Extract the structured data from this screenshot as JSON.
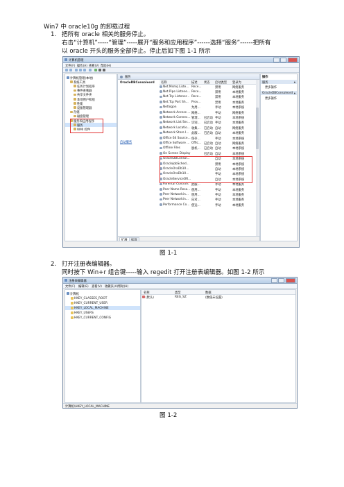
{
  "doc": {
    "title": "Win7 中 oracle10g  的卸载过程",
    "step1": {
      "number": "1.",
      "text": "把所有 oracle 相关的服务停止。"
    },
    "step1_desc_line1": "右击“计算机”-----“管理”-----展开“服务和应用程序”------选择“服务”------把所有",
    "step1_desc_line2": "以 oracle 开头的服务全部停止。停止后如下图 1-1 所示",
    "fig1_caption": "图 1-1",
    "step2": {
      "number": "2.",
      "text": "打开注册表编辑器。"
    },
    "step2_desc": "同时按下 Win+r 组合键-----输入 regedit 打开注册表编辑器。如图 1-2 所示",
    "fig2_caption": "图 1-2"
  },
  "screenshot1": {
    "title": "计算机管理",
    "menu": [
      "文件(F)",
      "操作(A)",
      "查看(V)",
      "帮助(H)"
    ],
    "tree": [
      {
        "label": "计算机管理(本地)",
        "indent": 0
      },
      {
        "label": "系统工具",
        "indent": 1
      },
      {
        "label": "任务计划程序",
        "indent": 2
      },
      {
        "label": "事件查看器",
        "indent": 2
      },
      {
        "label": "共享文件夹",
        "indent": 2
      },
      {
        "label": "本地用户和组",
        "indent": 2
      },
      {
        "label": "性能",
        "indent": 2
      },
      {
        "label": "设备管理器",
        "indent": 2
      },
      {
        "label": "存储",
        "indent": 1
      },
      {
        "label": "磁盘管理",
        "indent": 2
      },
      {
        "label": "服务和应用程序",
        "indent": 1
      },
      {
        "label": "服务",
        "indent": 2
      },
      {
        "label": "WMI 控件",
        "indent": 2
      }
    ],
    "header_label": "服务",
    "selected_service": "OracleDBConsoleord",
    "link_stop": "启动服务",
    "columns": [
      "名称",
      "描述",
      "状态",
      "启动类型",
      "登录为"
    ],
    "services": [
      [
        "Net.Msmq Liste...",
        "Rece...",
        "",
        "禁用",
        "网络服务"
      ],
      [
        "Net.Pipe Listene...",
        "Rece...",
        "",
        "禁用",
        "本地服务"
      ],
      [
        "Net.Tcp Listener...",
        "Rece...",
        "",
        "禁用",
        "本地服务"
      ],
      [
        "Net.Tcp Port Sh...",
        "Prov...",
        "",
        "禁用",
        "本地服务"
      ],
      [
        "Netlogon",
        "为用...",
        "",
        "手动",
        "本地系统"
      ],
      [
        "Network Access ...",
        "网络...",
        "",
        "手动",
        "网络服务"
      ],
      [
        "Network Connec...",
        "管理...",
        "已启动",
        "手动",
        "本地系统"
      ],
      [
        "Network List Ser...",
        "识别...",
        "已启动",
        "手动",
        "本地服务"
      ],
      [
        "Network Locatio...",
        "收集...",
        "已启动",
        "自动",
        "网络服务"
      ],
      [
        "Network Store I...",
        "此服...",
        "已启动",
        "自动",
        "本地服务"
      ],
      [
        "Office 64 Source...",
        "保存...",
        "",
        "手动",
        "本地系统"
      ],
      [
        "Office Software ...",
        "Offic...",
        "已启动",
        "自动",
        "网络服务"
      ],
      [
        "Offline Files",
        "脱机...",
        "已启动",
        "自动",
        "本地系统"
      ],
      [
        "On Screen Display",
        "",
        "已启动",
        "自动",
        "本地系统"
      ],
      [
        "OracleDBConsol...",
        "",
        "",
        "自动",
        "本地系统"
      ],
      [
        "OracleJobSched...",
        "",
        "",
        "禁用",
        "本地系统"
      ],
      [
        "OracleOraDb10...",
        "",
        "",
        "自动",
        "本地系统"
      ],
      [
        "OracleOraDb10...",
        "",
        "",
        "手动",
        "本地系统"
      ],
      [
        "OracleServiceOR...",
        "",
        "",
        "自动",
        "本地系统"
      ],
      [
        "Parental Controls",
        "此服...",
        "",
        "手动",
        "本地服务"
      ],
      [
        "Peer Name Reso...",
        "使用...",
        "",
        "手动",
        "本地服务"
      ],
      [
        "Peer Networkin...",
        "使用...",
        "",
        "手动",
        "本地服务"
      ],
      [
        "Peer Networkin...",
        "向对...",
        "",
        "手动",
        "本地服务"
      ],
      [
        "Performance Co...",
        "使远...",
        "",
        "手动",
        "本地服务"
      ]
    ],
    "tabs": [
      "扩展",
      "标准"
    ],
    "actions_title": "操作",
    "actions": [
      {
        "label": "服务",
        "kind": "header"
      },
      {
        "label": "更多操作",
        "kind": "item"
      },
      {
        "label": "OracleDBConsoleord",
        "kind": "header"
      },
      {
        "label": "更多操作",
        "kind": "item"
      }
    ]
  },
  "screenshot2": {
    "title": "注册表编辑器",
    "menu": [
      "文件(F)",
      "编辑(E)",
      "查看(V)",
      "收藏夹(A)",
      "帮助(H)"
    ],
    "tree": [
      {
        "label": "计算机",
        "indent": 0
      },
      {
        "label": "HKEY_CLASSES_ROOT",
        "indent": 1
      },
      {
        "label": "HKEY_CURRENT_USER",
        "indent": 1
      },
      {
        "label": "HKEY_LOCAL_MACHINE",
        "indent": 1
      },
      {
        "label": "HKEY_USERS",
        "indent": 1
      },
      {
        "label": "HKEY_CURRENT_CONFIG",
        "indent": 1
      }
    ],
    "columns": [
      "名称",
      "类型",
      "数据"
    ],
    "values": [
      [
        "(默认)",
        "REG_SZ",
        "(数值未设置)"
      ]
    ],
    "status": "计算机\\HKEY_LOCAL_MACHINE"
  },
  "colors": {
    "highlight_border": "#e03030",
    "selection": "#cfe3fb",
    "folder": "#e8c35a"
  }
}
